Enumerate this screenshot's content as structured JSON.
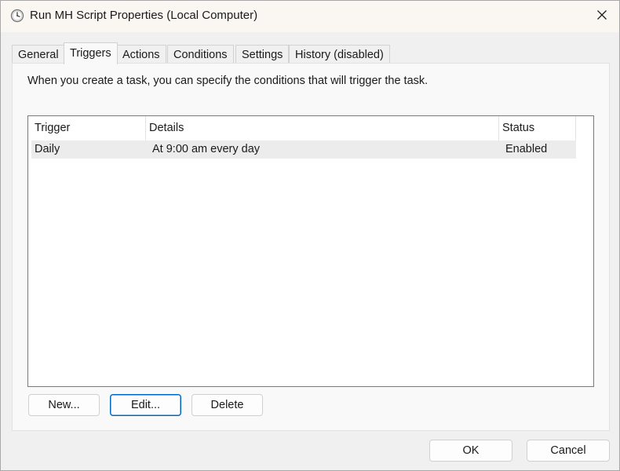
{
  "window": {
    "title": "Run MH Script Properties (Local Computer)",
    "icon": "clock-icon",
    "close_icon": "close-icon"
  },
  "tabs": [
    {
      "label": "General",
      "active": false
    },
    {
      "label": "Triggers",
      "active": true
    },
    {
      "label": "Actions",
      "active": false
    },
    {
      "label": "Conditions",
      "active": false
    },
    {
      "label": "Settings",
      "active": false
    },
    {
      "label": "History (disabled)",
      "active": false
    }
  ],
  "triggers": {
    "description": "When you create a task, you can specify the conditions that will trigger the task.",
    "columns": [
      "Trigger",
      "Details",
      "Status"
    ],
    "rows": [
      {
        "trigger": "Daily",
        "details": "At 9:00 am every day",
        "status": "Enabled"
      }
    ],
    "buttons": {
      "new": "New...",
      "edit": "Edit...",
      "delete": "Delete"
    }
  },
  "footer": {
    "ok": "OK",
    "cancel": "Cancel"
  },
  "colors": {
    "accent": "#0067c0",
    "selected_row": "#ececec"
  }
}
